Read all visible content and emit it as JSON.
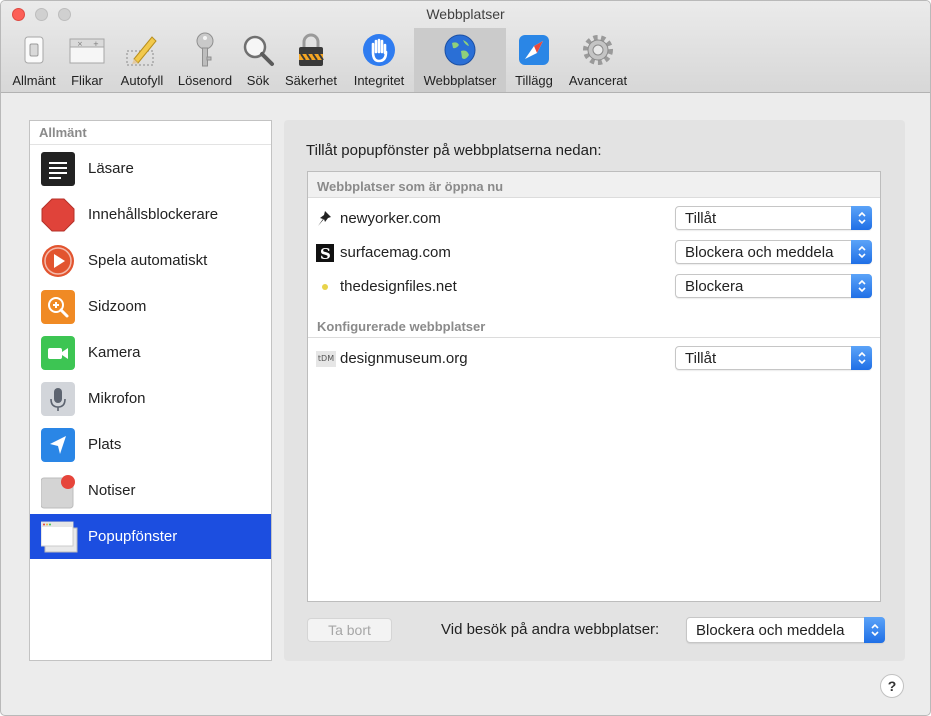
{
  "window": {
    "title": "Webbplatser"
  },
  "toolbar": {
    "items": [
      {
        "label": "Allmänt",
        "icon": "switch-icon"
      },
      {
        "label": "Flikar",
        "icon": "tabs-icon"
      },
      {
        "label": "Autofyll",
        "icon": "pencil-icon"
      },
      {
        "label": "Lösenord",
        "icon": "key-icon"
      },
      {
        "label": "Sök",
        "icon": "magnifier-icon"
      },
      {
        "label": "Säkerhet",
        "icon": "lock-icon"
      },
      {
        "label": "Integritet",
        "icon": "hand-icon"
      },
      {
        "label": "Webbplatser",
        "icon": "globe-icon",
        "active": true
      },
      {
        "label": "Tillägg",
        "icon": "puzzle-icon"
      },
      {
        "label": "Avancerat",
        "icon": "gear-icon"
      }
    ]
  },
  "sidebar": {
    "header": "Allmänt",
    "items": [
      {
        "label": "Läsare",
        "icon": "reader-icon"
      },
      {
        "label": "Innehållsblockerare",
        "icon": "stop-sign-icon"
      },
      {
        "label": "Spela automatiskt",
        "icon": "play-icon"
      },
      {
        "label": "Sidzoom",
        "icon": "zoom-icon"
      },
      {
        "label": "Kamera",
        "icon": "camera-icon"
      },
      {
        "label": "Mikrofon",
        "icon": "microphone-icon"
      },
      {
        "label": "Plats",
        "icon": "location-icon"
      },
      {
        "label": "Notiser",
        "icon": "notification-icon"
      },
      {
        "label": "Popupfönster",
        "icon": "popup-windows-icon",
        "selected": true
      }
    ]
  },
  "main": {
    "title": "Tillåt popupfönster på webbplatserna nedan:",
    "open_section": "Webbplatser som är öppna nu",
    "open_sites": [
      {
        "name": "newyorker.com",
        "setting": "Tillåt",
        "icon": "pin-favicon-icon"
      },
      {
        "name": "surfacemag.com",
        "setting": "Blockera och meddela",
        "icon": "s-favicon-icon"
      },
      {
        "name": "thedesignfiles.net",
        "setting": "Blockera",
        "icon": "dot-favicon-icon"
      }
    ],
    "configured_section": "Konfigurerade webbplatser",
    "configured_sites": [
      {
        "name": "designmuseum.org",
        "setting": "Tillåt",
        "icon": "dm-favicon-icon",
        "favicon_text": "tDM"
      }
    ],
    "remove_button": "Ta bort",
    "other_sites_label": "Vid besök på andra webbplatser:",
    "other_sites_setting": "Blockera och meddela"
  },
  "help": {
    "label": "?"
  },
  "colors": {
    "accent": "#1c4ee0",
    "close": "#fc5f57",
    "popup_arrow": "#2f7cf0"
  }
}
